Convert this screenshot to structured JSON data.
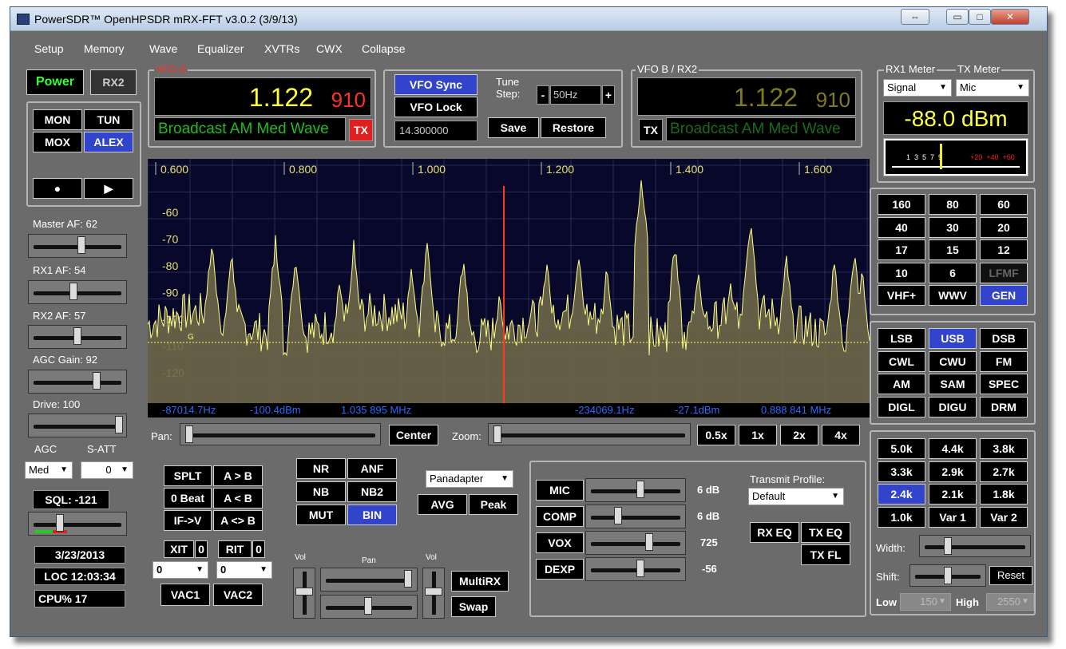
{
  "window": {
    "title": "PowerSDR™ OpenHPSDR mRX-FFT v3.0.2 (3/9/13)",
    "restore": "⇔",
    "minimize": "▭",
    "maximize": "□",
    "close": "✕"
  },
  "menu": [
    "Setup",
    "Memory",
    "Wave",
    "Equalizer",
    "XVTRs",
    "CWX",
    "Collapse"
  ],
  "left": {
    "power": "Power",
    "rx2": "RX2",
    "mon": "MON",
    "tun": "TUN",
    "mox": "MOX",
    "alex": "ALEX",
    "record": "●",
    "play": "▶",
    "master_af": "Master AF:  62",
    "rx1_af": "RX1 AF:  54",
    "rx2_af": "RX2 AF:  57",
    "agc_gain": "AGC Gain:  92",
    "drive": "Drive:  100",
    "agc": "AGC",
    "satt": "S-ATT",
    "agc_mode": "Med",
    "satt_val": "0",
    "sql": "SQL: -121",
    "date": "3/23/2013",
    "loc": "LOC 12:03:34",
    "cpu": "CPU%  17",
    "levels": {
      "master_af": 0.55,
      "rx1_af": 0.45,
      "rx2_af": 0.5,
      "agc_gain": 0.72,
      "drive": 0.98,
      "sql": 0.3
    }
  },
  "vfoa": {
    "legend": "VFO A",
    "mhz": "1.122",
    "hz": "910",
    "band": "Broadcast AM Med Wave",
    "tx": "TX"
  },
  "vfoctl": {
    "sync": "VFO Sync",
    "lock": "VFO Lock",
    "tune_step": "Tune\nStep:",
    "step": "50Hz",
    "minus": "-",
    "plus": "+",
    "freq": "14.300000",
    "save": "Save",
    "restore": "Restore"
  },
  "vfob": {
    "legend": "VFO B / RX2",
    "mhz": "1.122",
    "hz": "910",
    "band": "Broadcast AM Med Wave",
    "tx": "TX"
  },
  "meter": {
    "rx1": "RX1 Meter",
    "tx": "TX Meter",
    "sel_rx": "Signal",
    "sel_tx": "Mic",
    "value": "-88.0 dBm",
    "scale": "1  3  5  7  9",
    "scale_red": "+20  +40  +60"
  },
  "pan": {
    "freq_labels": [
      "0.600",
      "0.800",
      "1.000",
      "1.200",
      "1.400",
      "1.600"
    ],
    "db_labels": [
      "-60",
      "-70",
      "-80",
      "-90",
      "-100",
      "-110",
      "-120"
    ],
    "readout_left": [
      "-87014.7Hz",
      "-100.4dBm",
      "1.035 895 MHz"
    ],
    "readout_right": [
      "-234069.1Hz",
      "-27.1dBm",
      "0.888 841 MHz"
    ],
    "pan_label": "Pan:",
    "center": "Center",
    "zoom_label": "Zoom:",
    "zooms": [
      "0.5x",
      "1x",
      "2x",
      "4x"
    ],
    "sq": "G"
  },
  "bands": [
    "160",
    "80",
    "60",
    "40",
    "30",
    "20",
    "17",
    "15",
    "12",
    "10",
    "6",
    "LFMF",
    "VHF+",
    "WWV",
    "GEN"
  ],
  "modes": [
    "LSB",
    "USB",
    "DSB",
    "CWL",
    "CWU",
    "FM",
    "AM",
    "SAM",
    "SPEC",
    "DIGL",
    "DIGU",
    "DRM"
  ],
  "filters": [
    "5.0k",
    "4.4k",
    "3.8k",
    "3.3k",
    "2.9k",
    "2.7k",
    "2.4k",
    "2.1k",
    "1.8k",
    "1.0k",
    "Var 1",
    "Var 2"
  ],
  "filterctl": {
    "width": "Width:",
    "shift": "Shift:",
    "reset": "Reset",
    "low": "Low",
    "low_val": "150",
    "high": "High",
    "high_val": "2550"
  },
  "bottom": {
    "splt": "SPLT",
    "ab": "A > B",
    "beat": "0 Beat",
    "ba": "A < B",
    "ifv": "IF->V",
    "swap": "A <> B",
    "xit": "XIT",
    "xit_v": "0",
    "rit": "RIT",
    "rit_v": "0",
    "xit_f": "0",
    "rit_f": "0",
    "vac1": "VAC1",
    "vac2": "VAC2",
    "nr": "NR",
    "anf": "ANF",
    "nb": "NB",
    "nb2": "NB2",
    "mut": "MUT",
    "bin": "BIN",
    "display": "Panadapter",
    "avg": "AVG",
    "peak": "Peak",
    "vol": "Vol",
    "pan": "Pan",
    "vol2": "Vol",
    "multirx": "MultiRX",
    "swap2": "Swap"
  },
  "tx": {
    "mic": "MIC",
    "mic_v": "6 dB",
    "comp": "COMP",
    "comp_v": "6 dB",
    "vox": "VOX",
    "vox_v": "725",
    "dexp": "DEXP",
    "dexp_v": "-56",
    "profile_label": "Transmit Profile:",
    "profile": "Default",
    "rxeq": "RX EQ",
    "txeq": "TX EQ",
    "txfl": "TX FL",
    "levels": {
      "mic": 0.55,
      "comp": 0.3,
      "vox": 0.65,
      "dexp": 0.55
    }
  },
  "colors": {
    "active": "#3344cc",
    "vfo_a": "#ffff33",
    "vfo_a_hz": "#ff3322",
    "vfo_b": "#807a20",
    "band_green": "#22bb22",
    "meter": "#ffff44"
  }
}
